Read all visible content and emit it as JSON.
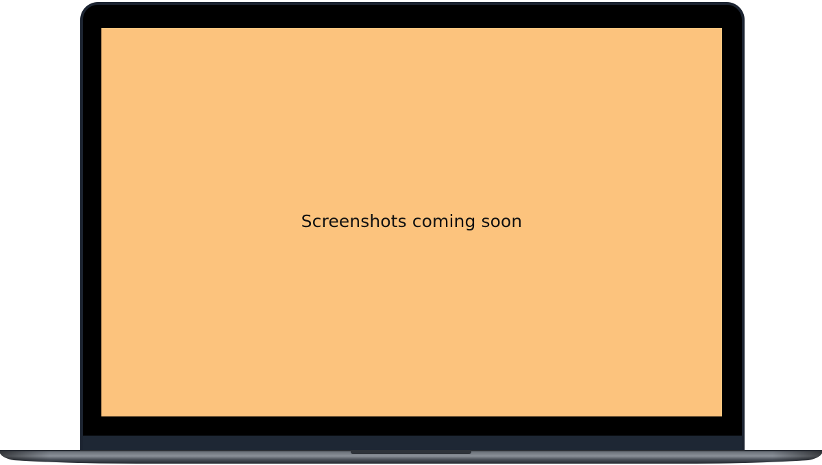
{
  "screen": {
    "message": "Screenshots coming soon",
    "background_color": "#fcc37d"
  },
  "device": {
    "frame_color": "#1c2431",
    "bezel_color": "#000000",
    "base_color": "#3a3f47"
  }
}
